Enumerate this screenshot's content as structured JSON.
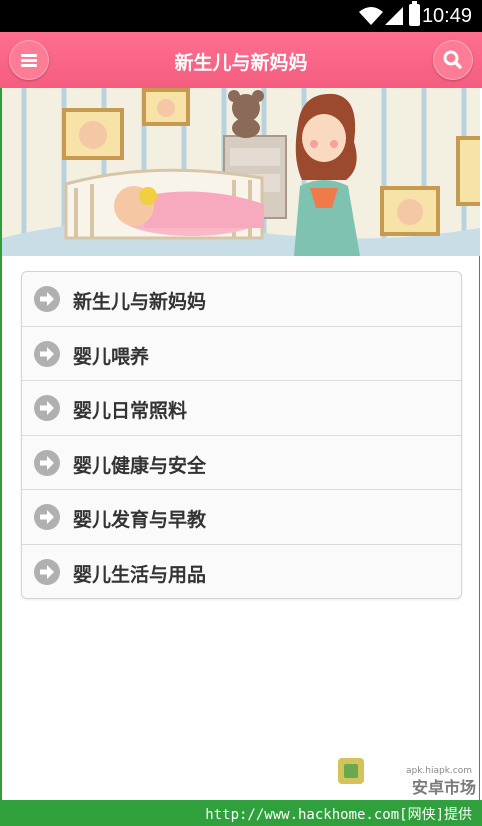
{
  "status_bar": {
    "time": "10:49"
  },
  "header": {
    "title": "新生儿与新妈妈"
  },
  "banner": {
    "alt": ""
  },
  "menu": {
    "items": [
      {
        "label": "新生儿与新妈妈"
      },
      {
        "label": "婴儿喂养"
      },
      {
        "label": "婴儿日常照料"
      },
      {
        "label": "婴儿健康与安全"
      },
      {
        "label": "婴儿发育与早教"
      },
      {
        "label": "婴儿生活与用品"
      }
    ]
  },
  "watermark": {
    "small": "apk.hiapk.com",
    "text": "安卓市场"
  },
  "footer": {
    "text": "http://www.hackhome.com[网侠]提供"
  },
  "colors": {
    "header": "#f45d80",
    "footer": "#2fa03b",
    "arrow": "#b0b0b0"
  }
}
